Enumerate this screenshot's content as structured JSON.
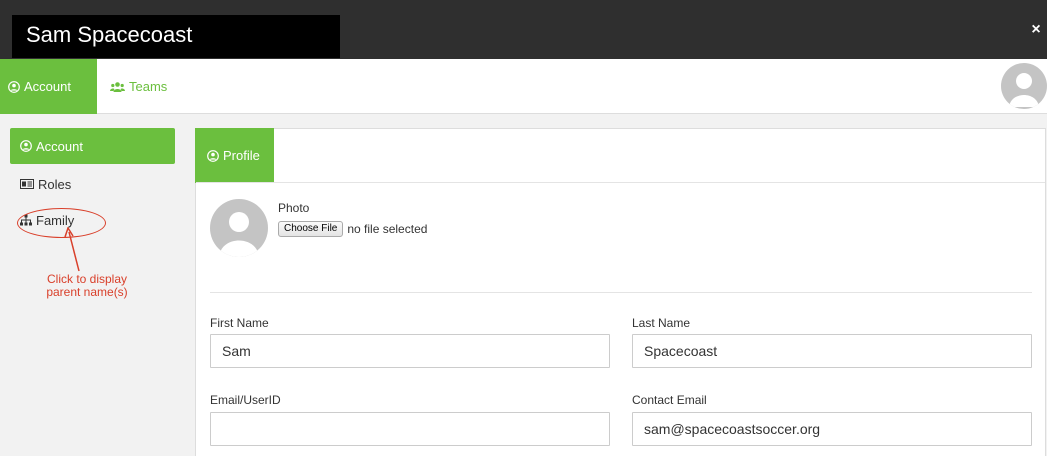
{
  "window": {
    "title": "Sam Spacecoast",
    "close_label": "×"
  },
  "topnav": {
    "tabs": [
      {
        "label": "Account",
        "icon": "user-circle-icon"
      },
      {
        "label": "Teams",
        "icon": "users-icon"
      }
    ],
    "avatar_icon": "user-avatar-icon"
  },
  "sidebar": {
    "items": [
      {
        "label": "Account",
        "icon": "user-circle-icon"
      },
      {
        "label": "Roles",
        "icon": "id-card-icon"
      },
      {
        "label": "Family",
        "icon": "sitemap-icon"
      }
    ]
  },
  "annotation": {
    "text": "Click to display parent name(s)"
  },
  "profile": {
    "tab_label": "Profile",
    "photo_label": "Photo",
    "choose_file_label": "Choose File",
    "file_status": "no file selected",
    "fields": {
      "first_name": {
        "label": "First Name",
        "value": "Sam"
      },
      "last_name": {
        "label": "Last Name",
        "value": "Spacecoast"
      },
      "email_userid": {
        "label": "Email/UserID",
        "value": ""
      },
      "contact_email": {
        "label": "Contact Email",
        "value": "sam@spacecoastsoccer.org"
      }
    }
  },
  "colors": {
    "accent": "#6bbf3e",
    "annotation": "#d9402b",
    "titlebar": "#2f2f2f"
  }
}
